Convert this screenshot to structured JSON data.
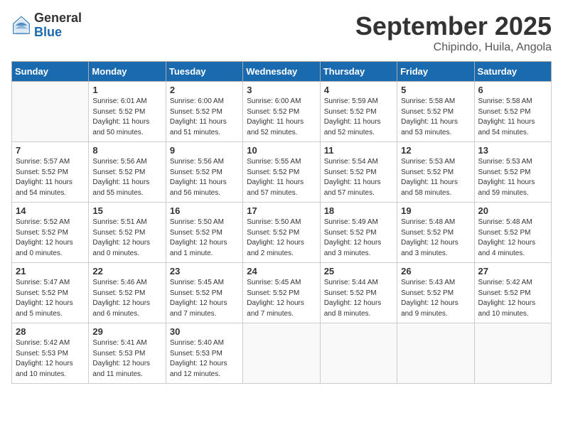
{
  "logo": {
    "general": "General",
    "blue": "Blue"
  },
  "title": "September 2025",
  "location": "Chipindo, Huila, Angola",
  "days_of_week": [
    "Sunday",
    "Monday",
    "Tuesday",
    "Wednesday",
    "Thursday",
    "Friday",
    "Saturday"
  ],
  "weeks": [
    [
      {
        "day": "",
        "info": ""
      },
      {
        "day": "1",
        "info": "Sunrise: 6:01 AM\nSunset: 5:52 PM\nDaylight: 11 hours\nand 50 minutes."
      },
      {
        "day": "2",
        "info": "Sunrise: 6:00 AM\nSunset: 5:52 PM\nDaylight: 11 hours\nand 51 minutes."
      },
      {
        "day": "3",
        "info": "Sunrise: 6:00 AM\nSunset: 5:52 PM\nDaylight: 11 hours\nand 52 minutes."
      },
      {
        "day": "4",
        "info": "Sunrise: 5:59 AM\nSunset: 5:52 PM\nDaylight: 11 hours\nand 52 minutes."
      },
      {
        "day": "5",
        "info": "Sunrise: 5:58 AM\nSunset: 5:52 PM\nDaylight: 11 hours\nand 53 minutes."
      },
      {
        "day": "6",
        "info": "Sunrise: 5:58 AM\nSunset: 5:52 PM\nDaylight: 11 hours\nand 54 minutes."
      }
    ],
    [
      {
        "day": "7",
        "info": "Sunrise: 5:57 AM\nSunset: 5:52 PM\nDaylight: 11 hours\nand 54 minutes."
      },
      {
        "day": "8",
        "info": "Sunrise: 5:56 AM\nSunset: 5:52 PM\nDaylight: 11 hours\nand 55 minutes."
      },
      {
        "day": "9",
        "info": "Sunrise: 5:56 AM\nSunset: 5:52 PM\nDaylight: 11 hours\nand 56 minutes."
      },
      {
        "day": "10",
        "info": "Sunrise: 5:55 AM\nSunset: 5:52 PM\nDaylight: 11 hours\nand 57 minutes."
      },
      {
        "day": "11",
        "info": "Sunrise: 5:54 AM\nSunset: 5:52 PM\nDaylight: 11 hours\nand 57 minutes."
      },
      {
        "day": "12",
        "info": "Sunrise: 5:53 AM\nSunset: 5:52 PM\nDaylight: 11 hours\nand 58 minutes."
      },
      {
        "day": "13",
        "info": "Sunrise: 5:53 AM\nSunset: 5:52 PM\nDaylight: 11 hours\nand 59 minutes."
      }
    ],
    [
      {
        "day": "14",
        "info": "Sunrise: 5:52 AM\nSunset: 5:52 PM\nDaylight: 12 hours\nand 0 minutes."
      },
      {
        "day": "15",
        "info": "Sunrise: 5:51 AM\nSunset: 5:52 PM\nDaylight: 12 hours\nand 0 minutes."
      },
      {
        "day": "16",
        "info": "Sunrise: 5:50 AM\nSunset: 5:52 PM\nDaylight: 12 hours\nand 1 minute."
      },
      {
        "day": "17",
        "info": "Sunrise: 5:50 AM\nSunset: 5:52 PM\nDaylight: 12 hours\nand 2 minutes."
      },
      {
        "day": "18",
        "info": "Sunrise: 5:49 AM\nSunset: 5:52 PM\nDaylight: 12 hours\nand 3 minutes."
      },
      {
        "day": "19",
        "info": "Sunrise: 5:48 AM\nSunset: 5:52 PM\nDaylight: 12 hours\nand 3 minutes."
      },
      {
        "day": "20",
        "info": "Sunrise: 5:48 AM\nSunset: 5:52 PM\nDaylight: 12 hours\nand 4 minutes."
      }
    ],
    [
      {
        "day": "21",
        "info": "Sunrise: 5:47 AM\nSunset: 5:52 PM\nDaylight: 12 hours\nand 5 minutes."
      },
      {
        "day": "22",
        "info": "Sunrise: 5:46 AM\nSunset: 5:52 PM\nDaylight: 12 hours\nand 6 minutes."
      },
      {
        "day": "23",
        "info": "Sunrise: 5:45 AM\nSunset: 5:52 PM\nDaylight: 12 hours\nand 7 minutes."
      },
      {
        "day": "24",
        "info": "Sunrise: 5:45 AM\nSunset: 5:52 PM\nDaylight: 12 hours\nand 7 minutes."
      },
      {
        "day": "25",
        "info": "Sunrise: 5:44 AM\nSunset: 5:52 PM\nDaylight: 12 hours\nand 8 minutes."
      },
      {
        "day": "26",
        "info": "Sunrise: 5:43 AM\nSunset: 5:52 PM\nDaylight: 12 hours\nand 9 minutes."
      },
      {
        "day": "27",
        "info": "Sunrise: 5:42 AM\nSunset: 5:52 PM\nDaylight: 12 hours\nand 10 minutes."
      }
    ],
    [
      {
        "day": "28",
        "info": "Sunrise: 5:42 AM\nSunset: 5:53 PM\nDaylight: 12 hours\nand 10 minutes."
      },
      {
        "day": "29",
        "info": "Sunrise: 5:41 AM\nSunset: 5:53 PM\nDaylight: 12 hours\nand 11 minutes."
      },
      {
        "day": "30",
        "info": "Sunrise: 5:40 AM\nSunset: 5:53 PM\nDaylight: 12 hours\nand 12 minutes."
      },
      {
        "day": "",
        "info": ""
      },
      {
        "day": "",
        "info": ""
      },
      {
        "day": "",
        "info": ""
      },
      {
        "day": "",
        "info": ""
      }
    ]
  ]
}
